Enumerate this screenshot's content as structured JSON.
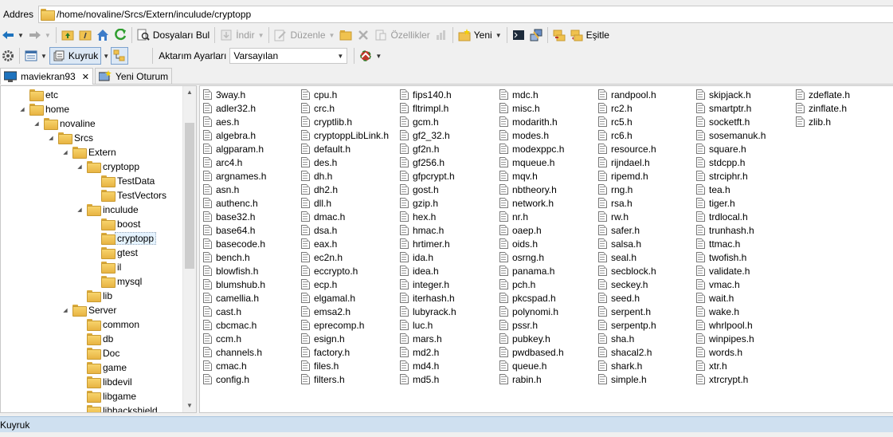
{
  "address": {
    "label": "Addres",
    "path": "/home/novaline/Srcs/Extern/inculude/cryptopp"
  },
  "toolbar1": {
    "find_files": "Dosyaları Bul",
    "download": "İndir",
    "edit": "Düzenle",
    "properties": "Özellikler",
    "new": "Yeni",
    "sync": "Eşitle"
  },
  "toolbar2": {
    "queue": "Kuyruk",
    "transfer_settings_label": "Aktarım Ayarları",
    "transfer_settings_value": "Varsayılan"
  },
  "tabs": [
    {
      "label": "maviekran93",
      "closable": true
    },
    {
      "label": "Yeni Oturum",
      "closable": false
    }
  ],
  "tree": [
    {
      "label": "etc",
      "expanded": false
    },
    {
      "label": "home",
      "expanded": true
    },
    {
      "label": "novaline",
      "expanded": true
    },
    {
      "label": "Srcs",
      "expanded": true
    },
    {
      "label": "Extern",
      "expanded": true
    },
    {
      "label": "cryptopp",
      "expanded": true
    },
    {
      "label": "TestData",
      "expanded": false
    },
    {
      "label": "TestVectors",
      "expanded": false
    },
    {
      "label": "inculude",
      "expanded": true
    },
    {
      "label": "boost",
      "expanded": false
    },
    {
      "label": "cryptopp",
      "expanded": false,
      "selected": true
    },
    {
      "label": "gtest",
      "expanded": false
    },
    {
      "label": "il",
      "expanded": false
    },
    {
      "label": "mysql",
      "expanded": false
    },
    {
      "label": "lib",
      "expanded": false
    },
    {
      "label": "Server",
      "expanded": true
    },
    {
      "label": "common",
      "expanded": false
    },
    {
      "label": "db",
      "expanded": false
    },
    {
      "label": "Doc",
      "expanded": false
    },
    {
      "label": "game",
      "expanded": false
    },
    {
      "label": "libdevil",
      "expanded": false
    },
    {
      "label": "libgame",
      "expanded": false
    },
    {
      "label": "libhackshield",
      "expanded": false
    }
  ],
  "files": [
    "3way.h",
    "adler32.h",
    "aes.h",
    "algebra.h",
    "algparam.h",
    "arc4.h",
    "argnames.h",
    "asn.h",
    "authenc.h",
    "base32.h",
    "base64.h",
    "basecode.h",
    "bench.h",
    "blowfish.h",
    "blumshub.h",
    "camellia.h",
    "cast.h",
    "cbcmac.h",
    "ccm.h",
    "channels.h",
    "cmac.h",
    "config.h",
    "cpu.h",
    "crc.h",
    "cryptlib.h",
    "cryptoppLibLink.h",
    "default.h",
    "des.h",
    "dh.h",
    "dh2.h",
    "dll.h",
    "dmac.h",
    "dsa.h",
    "eax.h",
    "ec2n.h",
    "eccrypto.h",
    "ecp.h",
    "elgamal.h",
    "emsa2.h",
    "eprecomp.h",
    "esign.h",
    "factory.h",
    "files.h",
    "filters.h",
    "fips140.h",
    "fltrimpl.h",
    "gcm.h",
    "gf2_32.h",
    "gf2n.h",
    "gf256.h",
    "gfpcrypt.h",
    "gost.h",
    "gzip.h",
    "hex.h",
    "hmac.h",
    "hrtimer.h",
    "ida.h",
    "idea.h",
    "integer.h",
    "iterhash.h",
    "lubyrack.h",
    "luc.h",
    "mars.h",
    "md2.h",
    "md4.h",
    "md5.h",
    "mdc.h",
    "misc.h",
    "modarith.h",
    "modes.h",
    "modexppc.h",
    "mqueue.h",
    "mqv.h",
    "nbtheory.h",
    "network.h",
    "nr.h",
    "oaep.h",
    "oids.h",
    "osrng.h",
    "panama.h",
    "pch.h",
    "pkcspad.h",
    "polynomi.h",
    "pssr.h",
    "pubkey.h",
    "pwdbased.h",
    "queue.h",
    "rabin.h",
    "randpool.h",
    "rc2.h",
    "rc5.h",
    "rc6.h",
    "resource.h",
    "rijndael.h",
    "ripemd.h",
    "rng.h",
    "rsa.h",
    "rw.h",
    "safer.h",
    "salsa.h",
    "seal.h",
    "secblock.h",
    "seckey.h",
    "seed.h",
    "serpent.h",
    "serpentp.h",
    "sha.h",
    "shacal2.h",
    "shark.h",
    "simple.h",
    "skipjack.h",
    "smartptr.h",
    "socketft.h",
    "sosemanuk.h",
    "square.h",
    "stdcpp.h",
    "strciphr.h",
    "tea.h",
    "tiger.h",
    "trdlocal.h",
    "trunhash.h",
    "ttmac.h",
    "twofish.h",
    "validate.h",
    "vmac.h",
    "wait.h",
    "wake.h",
    "whrlpool.h",
    "winpipes.h",
    "words.h",
    "xtr.h",
    "xtrcrypt.h",
    "zdeflate.h",
    "zinflate.h",
    "zlib.h"
  ],
  "queue_bar": {
    "label": "Kuyruk"
  },
  "colors": {
    "folder": "#f0c24f",
    "accent": "#1e73be",
    "queue_bar": "#cfe0f0",
    "selection": "#e5f3ff"
  }
}
